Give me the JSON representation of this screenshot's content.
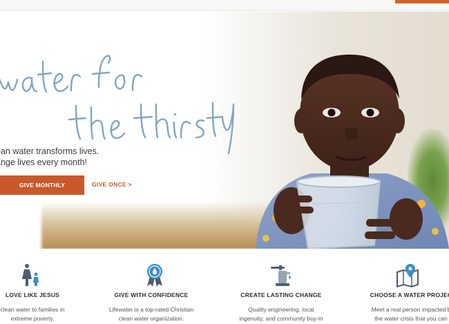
{
  "hero": {
    "script_title": "water for the thirsty",
    "tagline_line1": "ean water transforms lives.",
    "tagline_line2": "ange lives every month!",
    "give_monthly_label": "GIVE MONTHLY",
    "give_once_label": "GIVE ONCE >"
  },
  "features": [
    {
      "icon": "family-icon",
      "title": "LOVE LIKE JESUS",
      "text_line1": "clean water to families in",
      "text_line2": "extreme poverty."
    },
    {
      "icon": "award-ribbon-icon",
      "title": "GIVE WITH CONFIDENCE",
      "text_line1": "Lifewater is a top-rated Christian",
      "text_line2": "clean water organization."
    },
    {
      "icon": "water-pump-icon",
      "title": "CREATE LASTING CHANGE",
      "text_line1": "Quality engineering, local",
      "text_line2": "ingenuity, and community buy-in"
    },
    {
      "icon": "map-pin-icon",
      "title": "CHOOSE A WATER PROJEC",
      "text_line1": "Meet a real person impacted b",
      "text_line2": "the water crisis that you can"
    }
  ],
  "colors": {
    "accent": "#c9582a",
    "script_blue": "#7fa6c4",
    "icon_blue": "#3a8fc7",
    "icon_slate": "#4f5d70"
  }
}
